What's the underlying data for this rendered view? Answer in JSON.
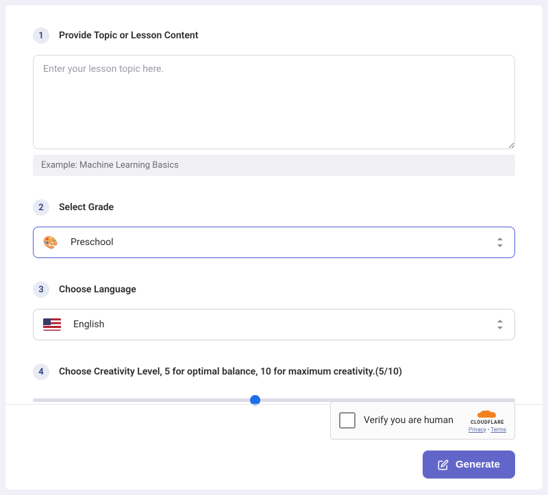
{
  "step1": {
    "number": "1",
    "label": "Provide Topic or Lesson Content",
    "placeholder": "Enter your lesson topic here.",
    "example_prefix": "Example:  ",
    "example_text": "Machine Learning Basics"
  },
  "step2": {
    "number": "2",
    "label": "Select Grade",
    "value": "Preschool",
    "icon": "🎨"
  },
  "step3": {
    "number": "3",
    "label": "Choose Language",
    "value": "English"
  },
  "step4": {
    "number": "4",
    "label": "Choose Creativity Level, 5 for optimal balance, 10 for maximum creativity.(5/10)",
    "value": 5,
    "min": 0,
    "max": 10
  },
  "captcha": {
    "label": "Verify you are human",
    "brand": "CLOUDFLARE",
    "privacy": "Privacy",
    "terms": "Terms"
  },
  "generate": {
    "label": "Generate"
  }
}
